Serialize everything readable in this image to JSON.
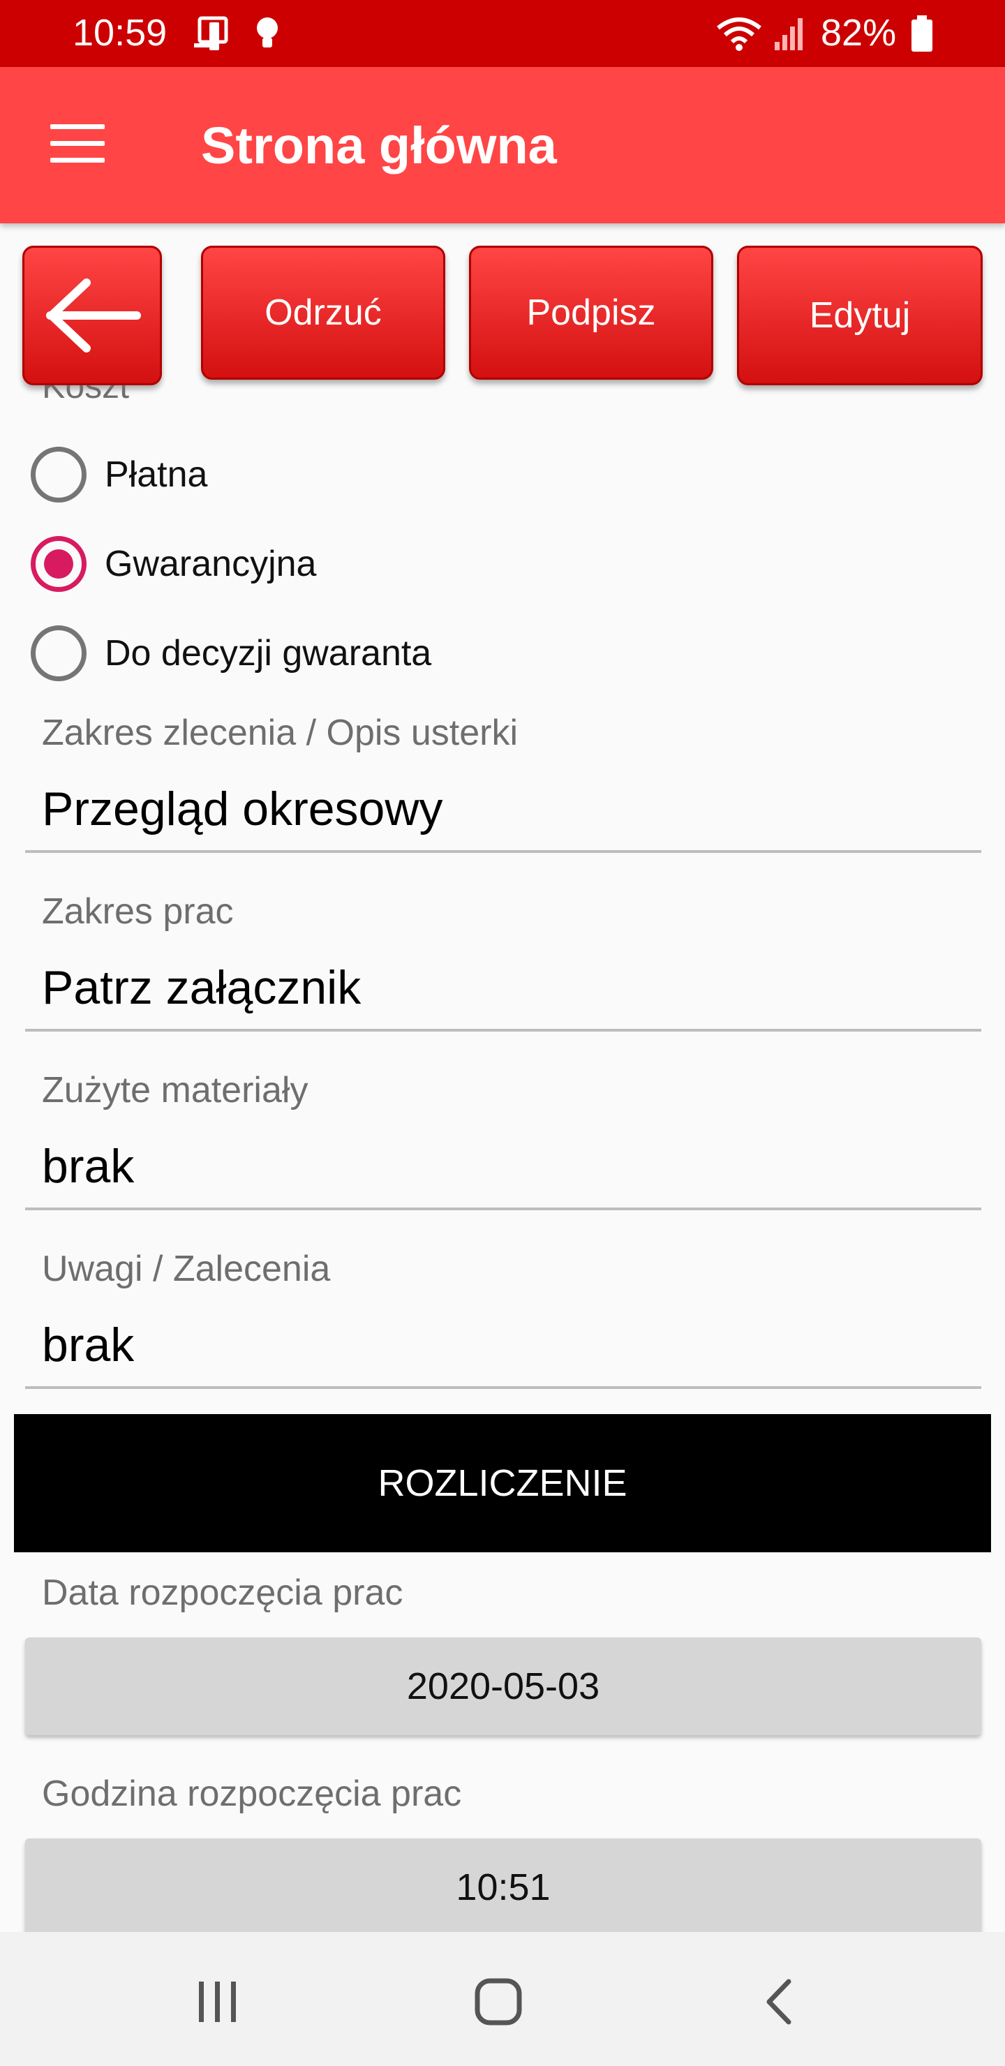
{
  "status_bar": {
    "time": "10:59",
    "battery_pct": "82%",
    "icons": [
      "phone-notification-icon",
      "bulb-icon",
      "wifi-icon",
      "signal-icon",
      "battery-icon"
    ]
  },
  "app_bar": {
    "title": "Strona główna",
    "menu_icon": "hamburger-menu-icon"
  },
  "actions": {
    "back_icon": "arrow-left-icon",
    "reject_label": "Odrzuć",
    "sign_label": "Podpisz",
    "edit_label": "Edytuj"
  },
  "cost": {
    "label": "Koszt",
    "options": [
      {
        "label": "Płatna",
        "selected": false
      },
      {
        "label": "Gwarancyjna",
        "selected": true
      },
      {
        "label": "Do decyzji gwaranta",
        "selected": false
      }
    ]
  },
  "fields": [
    {
      "label": "Zakres zlecenia / Opis usterki",
      "value": "Przegląd okresowy"
    },
    {
      "label": "Zakres prac",
      "value": "Patrz załącznik"
    },
    {
      "label": "Zużyte materiały",
      "value": "brak"
    },
    {
      "label": "Uwagi / Zalecenia",
      "value": "brak"
    }
  ],
  "settlement": {
    "section_title": "ROZLICZENIE",
    "start_date_label": "Data rozpoczęcia prac",
    "start_date_value": "2020-05-03",
    "start_time_label": "Godzina rozpoczęcia prac",
    "start_time_value": "10:51"
  },
  "nav_bar": {
    "recent_icon": "recent-apps-icon",
    "home_icon": "home-icon",
    "back_icon": "back-chevron-icon"
  },
  "colors": {
    "status_bar": "#cc0000",
    "app_bar": "#ff4545",
    "radio_accent": "#d81b60",
    "section_bar": "#000000",
    "picker_bg": "#d6d6d6"
  }
}
